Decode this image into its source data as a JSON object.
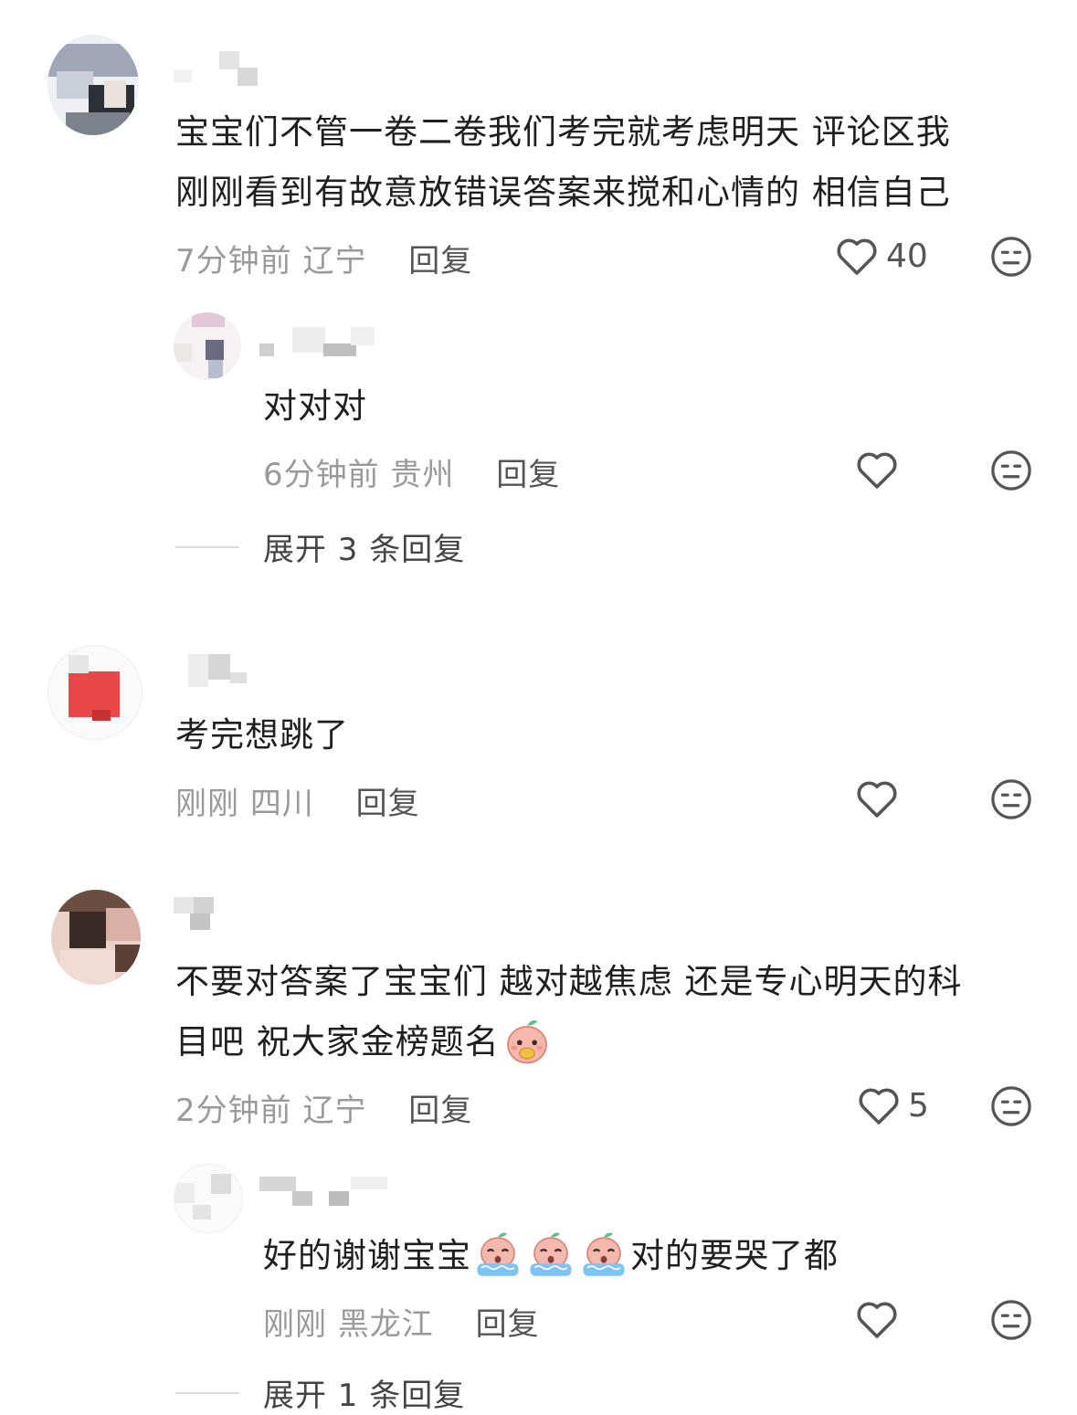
{
  "comments": [
    {
      "text_line1": "宝宝们不管一卷二卷我们考完就考虑明天 评论区我",
      "text_line2": "刚刚看到有故意放错误答案来搅和心情的 相信自己",
      "time": "7分钟前",
      "location": "辽宁",
      "reply_label": "回复",
      "likes": "40"
    },
    {
      "text": "对对对",
      "time": "6分钟前",
      "location": "贵州",
      "reply_label": "回复",
      "likes": ""
    },
    {
      "text": "考完想跳了",
      "time": "刚刚",
      "location": "四川",
      "reply_label": "回复",
      "likes": ""
    },
    {
      "text_line1": "不要对答案了宝宝们 越对越焦虑 还是专心明天的科",
      "text_line2": "目吧 祝大家金榜题名",
      "time": "2分钟前",
      "location": "辽宁",
      "reply_label": "回复",
      "likes": "5"
    },
    {
      "text_before": "好的谢谢宝宝",
      "text_after": "对的要哭了都",
      "time": "刚刚",
      "location": "黑龙江",
      "reply_label": "回复",
      "likes": ""
    }
  ],
  "expand": [
    {
      "label": "展开 3 条回复"
    },
    {
      "label": "展开 1 条回复"
    }
  ],
  "icons": {
    "like": "heart-outline-icon",
    "meh": "meh-face-icon",
    "emoji_happy": "peach-emoji-icon",
    "emoji_cry": "peach-crying-emoji-icon"
  },
  "colors": {
    "text": "#1f1f1f",
    "meta": "#9a9a9a",
    "reply": "#555555"
  }
}
